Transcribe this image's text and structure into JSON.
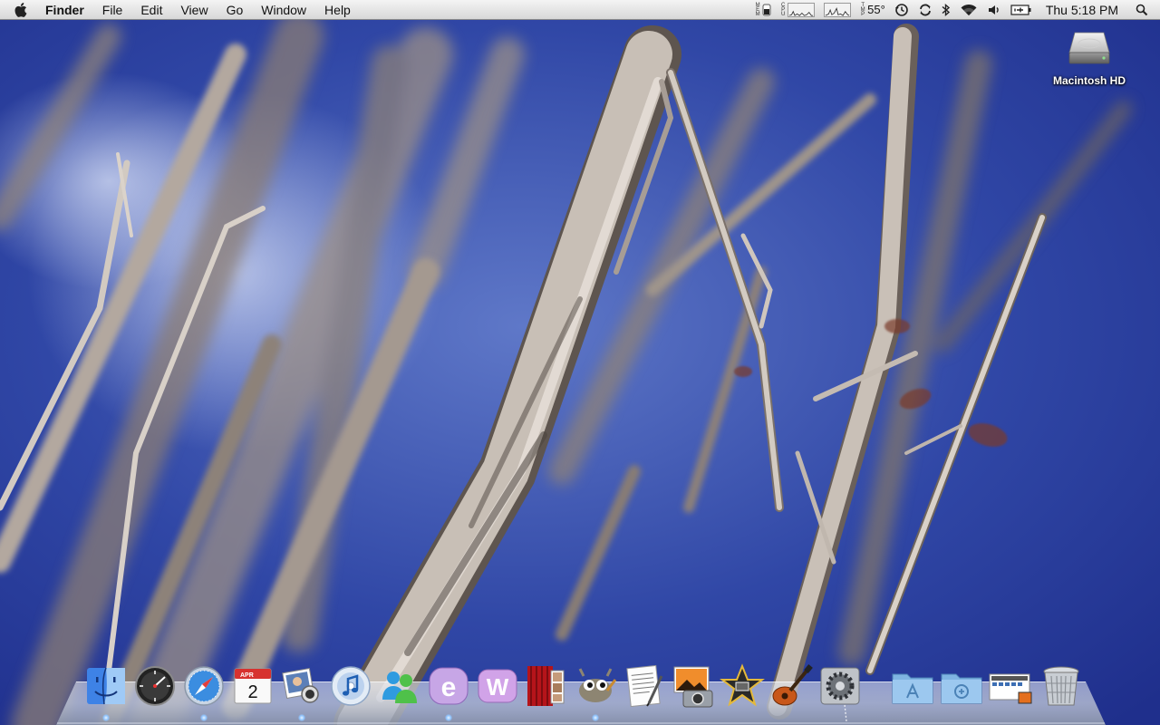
{
  "menubar": {
    "apple_icon": "apple-icon",
    "app_name": "Finder",
    "menus": [
      "File",
      "Edit",
      "View",
      "Go",
      "Window",
      "Help"
    ],
    "status": {
      "mem_label": "MEM",
      "cpu_label": "CPU",
      "tmp_label": "TMP",
      "temperature": "55°",
      "icons": [
        "time-machine-icon",
        "sync-icon",
        "bluetooth-icon",
        "wifi-icon",
        "volume-icon",
        "battery-icon"
      ],
      "clock": "Thu 5:18 PM",
      "spotlight_icon": "spotlight-search-icon"
    }
  },
  "desktop": {
    "drive_label": "Macintosh HD"
  },
  "dock": {
    "apps": [
      "finder-icon",
      "dashboard-icon",
      "safari-icon",
      "ical-icon",
      "address-book-icon",
      "itunes-icon",
      "messenger-icon",
      "eclipse-icon",
      "web-app-icon",
      "photo-booth-icon",
      "gimp-icon",
      "textedit-icon",
      "image-capture-icon",
      "imovie-icon",
      "garageband-icon",
      "system-preferences-icon"
    ],
    "ical_month": "APR",
    "ical_day": "2",
    "stacks": [
      "applications-folder-icon",
      "documents-folder-icon",
      "screenshots-stack-icon",
      "trash-icon"
    ]
  },
  "colors": {
    "sky": "#2a3e9a",
    "menubar_top": "#f4f4f4",
    "menubar_bottom": "#d8d8d8",
    "run_indicator": "#8fc4ff"
  }
}
